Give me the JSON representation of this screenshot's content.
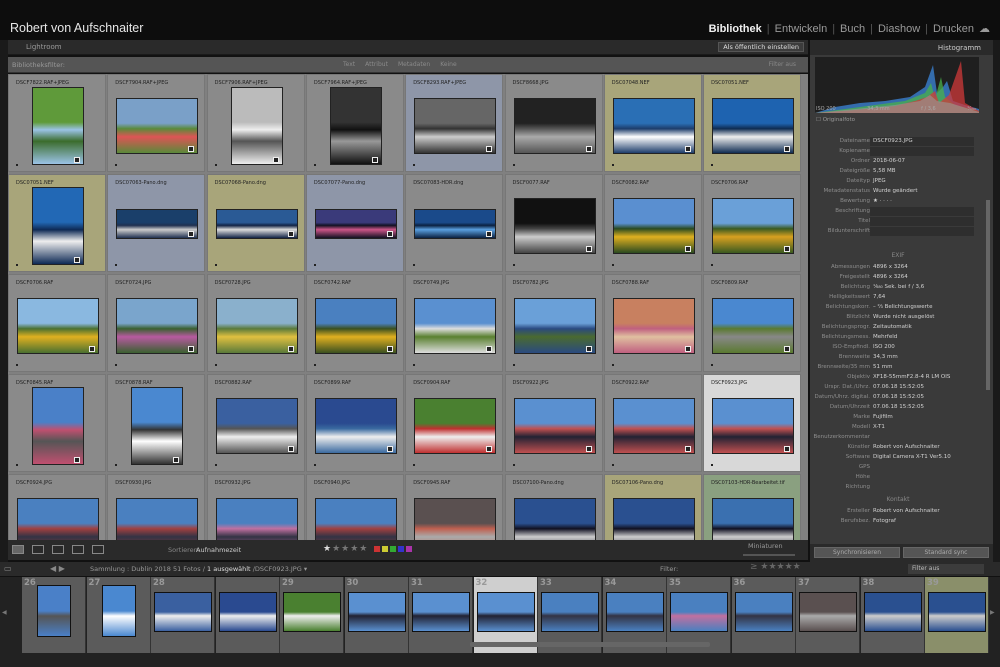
{
  "header": {
    "user": "Robert von Aufschnaiter",
    "modules": [
      "Bibliothek",
      "Entwickeln",
      "Buch",
      "Diashow",
      "Drucken"
    ],
    "active": "Bibliothek"
  },
  "pathbar": {
    "label": "Lightroom",
    "publish": "Als öffentlich einstellen"
  },
  "filterbar": {
    "title": "Bibliotheksfilter:",
    "tabs": [
      "Text",
      "Attribut",
      "Metadaten",
      "Keine"
    ],
    "off": "Filter aus"
  },
  "grid": [
    {
      "name": "DSCF7822.RAF+JPEG",
      "tone": "v",
      "colors": [
        "#5f9a3a",
        "#3b6c2c",
        "#9bc3e6"
      ],
      "bg": ""
    },
    {
      "name": "DSCF7904.RAF+JPEG",
      "tone": "h",
      "colors": [
        "#7aa0c8",
        "#d55",
        "#5a8a3a"
      ],
      "bg": ""
    },
    {
      "name": "DSCF7906.RAF+JPEG",
      "tone": "v",
      "colors": [
        "#bbb",
        "#555",
        "#eee"
      ],
      "bg": ""
    },
    {
      "name": "DSCF7964.RAF+JPEG",
      "tone": "v",
      "colors": [
        "#333",
        "#999",
        "#111"
      ],
      "bg": "#8a8a8a"
    },
    {
      "name": "DSCF8293.RAF+JPEG",
      "tone": "h",
      "colors": [
        "#666",
        "#ccc",
        "#333"
      ],
      "bg": "#8e96a8"
    },
    {
      "name": "DSCF8668.JPG",
      "tone": "h",
      "colors": [
        "#222",
        "#aaa",
        "#555"
      ],
      "bg": ""
    },
    {
      "name": "DSC07048.NEF",
      "tone": "h",
      "colors": [
        "#2a6fb5",
        "#fff",
        "#1d3d6b"
      ],
      "bg": "#a8a57a"
    },
    {
      "name": "DSC07051.NEF",
      "tone": "h",
      "colors": [
        "#1e63b0",
        "#eee",
        "#0f2c52"
      ],
      "bg": "#a8a57a"
    },
    {
      "name": "DSC07051.NEF",
      "tone": "v",
      "colors": [
        "#2268b5",
        "#eee",
        "#0e2a55"
      ],
      "bg": "#a8a57a"
    },
    {
      "name": "DSC07063-Pano.dng",
      "tone": "p",
      "colors": [
        "#1a3f6a",
        "#ccc",
        "#203050"
      ],
      "bg": "#8e96a8"
    },
    {
      "name": "DSC07068-Pano.dng",
      "tone": "p",
      "colors": [
        "#2a5a95",
        "#ddd",
        "#112244"
      ],
      "bg": "#a8a57a"
    },
    {
      "name": "DSC07077-Pano.dng",
      "tone": "p",
      "colors": [
        "#3a3a7a",
        "#c58",
        "#112"
      ],
      "bg": "#8e96a8"
    },
    {
      "name": "DSC07083-HDR.dng",
      "tone": "p",
      "colors": [
        "#1a4a8a",
        "#5aa0e0",
        "#0a2040"
      ],
      "bg": ""
    },
    {
      "name": "DSCF0077.RAF",
      "tone": "h",
      "colors": [
        "#111",
        "#ccc",
        "#444"
      ],
      "bg": ""
    },
    {
      "name": "DSCF0082.RAF",
      "tone": "h",
      "colors": [
        "#5a8fd0",
        "#e0b020",
        "#2a4a20"
      ],
      "bg": ""
    },
    {
      "name": "DSCF0706.RAF",
      "tone": "h",
      "colors": [
        "#6aa0d8",
        "#d8a020",
        "#3a5a20"
      ],
      "bg": ""
    },
    {
      "name": "DSCF0706.RAF",
      "tone": "h",
      "colors": [
        "#8ab8e0",
        "#e0b020",
        "#4a7030"
      ],
      "bg": ""
    },
    {
      "name": "DSCF0724.JPG",
      "tone": "h",
      "colors": [
        "#7aa5cc",
        "#b75aa0",
        "#3a6030"
      ],
      "bg": ""
    },
    {
      "name": "DSCF0728.JPG",
      "tone": "h",
      "colors": [
        "#8ab0cc",
        "#e0c040",
        "#5a7a3a"
      ],
      "bg": ""
    },
    {
      "name": "DSCF0742.RAF",
      "tone": "h",
      "colors": [
        "#4a80c0",
        "#e0b020",
        "#3a5020"
      ],
      "bg": ""
    },
    {
      "name": "DSCF0749.JPG",
      "tone": "h",
      "colors": [
        "#5a90d0",
        "#5a8030",
        "#ddd"
      ],
      "bg": ""
    },
    {
      "name": "DSCF0782.JPG",
      "tone": "h",
      "colors": [
        "#6aa0d8",
        "#4a6a30",
        "#2a4a80"
      ],
      "bg": ""
    },
    {
      "name": "DSCF0788.RAF",
      "tone": "h",
      "colors": [
        "#c88060",
        "#e0c0a0",
        "#c06080"
      ],
      "bg": ""
    },
    {
      "name": "DSCF0809.RAF",
      "tone": "h",
      "colors": [
        "#4a88d0",
        "#888",
        "#5a7a30"
      ],
      "bg": ""
    },
    {
      "name": "DSCF0845.RAF",
      "tone": "v",
      "colors": [
        "#4a80c8",
        "#555",
        "#c05070"
      ],
      "bg": ""
    },
    {
      "name": "DSCF0878.RAF",
      "tone": "v",
      "colors": [
        "#4a88d0",
        "#fff",
        "#333"
      ],
      "bg": ""
    },
    {
      "name": "DSCF0882.RAF",
      "tone": "h",
      "colors": [
        "#3a60a0",
        "#eee",
        "#555"
      ],
      "bg": ""
    },
    {
      "name": "DSCF0899.RAF",
      "tone": "h",
      "colors": [
        "#2a4a90",
        "#eee",
        "#3a6aa0"
      ],
      "bg": ""
    },
    {
      "name": "DSCF0904.RAF",
      "tone": "h",
      "colors": [
        "#4a8030",
        "#eee",
        "#c03030"
      ],
      "bg": ""
    },
    {
      "name": "DSCF0922.JPG",
      "tone": "h",
      "colors": [
        "#5a90d0",
        "#223",
        "#c05050"
      ],
      "bg": ""
    },
    {
      "name": "DSCF0922.RAF",
      "tone": "h",
      "colors": [
        "#5a90d0",
        "#223",
        "#c05050"
      ],
      "bg": ""
    },
    {
      "name": "DSCF0923.JPG",
      "tone": "h",
      "colors": [
        "#5a90d0",
        "#223",
        "#c05050"
      ],
      "bg": "#d8d8d8",
      "sel": true
    },
    {
      "name": "DSCF0924.JPG",
      "tone": "h",
      "colors": [
        "#4a80c0",
        "#334",
        "#a04040"
      ],
      "bg": ""
    },
    {
      "name": "DSCF0930.JPG",
      "tone": "h",
      "colors": [
        "#4a80c0",
        "#334",
        "#a04040"
      ],
      "bg": ""
    },
    {
      "name": "DSCF0932.JPG",
      "tone": "h",
      "colors": [
        "#4a80c0",
        "#334",
        "#c070a0"
      ],
      "bg": ""
    },
    {
      "name": "DSCF0940.JPG",
      "tone": "h",
      "colors": [
        "#4a80c0",
        "#334",
        "#a04040"
      ],
      "bg": ""
    },
    {
      "name": "DSCF0945.RAF",
      "tone": "h",
      "colors": [
        "#5a5050",
        "#aaa",
        "#c06050"
      ],
      "bg": ""
    },
    {
      "name": "DSC07100-Pano.dng",
      "tone": "h",
      "colors": [
        "#2a5090",
        "#ccc",
        "#112"
      ],
      "bg": ""
    },
    {
      "name": "DSC07106-Pano.dng",
      "tone": "h",
      "colors": [
        "#2a5090",
        "#ccc",
        "#112"
      ],
      "bg": "#a8a57a"
    },
    {
      "name": "DSC07103-HDR-Bearbeitet.tif",
      "tone": "h",
      "colors": [
        "#3a70b0",
        "#ccc",
        "#112"
      ],
      "bg": "#8aa080"
    }
  ],
  "toolbar": {
    "sort_label": "Sortieren:",
    "sort_value": "Aufnahmezeit",
    "thumbs_label": "Miniaturen"
  },
  "histogram": {
    "title": "Histogramm",
    "iso": "ISO 200",
    "focal": "34,3 mm",
    "aperture": "f / 3,6",
    "shutter": "¹⁄₆₈₀",
    "original": "Originalfoto"
  },
  "metadata": [
    {
      "k": "Dateiname",
      "v": "DSCF0923.JPG",
      "f": true
    },
    {
      "k": "Kopiename",
      "v": "",
      "f": true
    },
    {
      "k": "Ordner",
      "v": "2018-06-07"
    },
    {
      "k": "Dateigröße",
      "v": "5,58 MB"
    },
    {
      "k": "Dateityp",
      "v": "JPEG"
    },
    {
      "k": "Metadatenstatus",
      "v": "Wurde geändert"
    },
    {
      "k": "Bewertung",
      "v": "★ · · · ·"
    },
    {
      "k": "Beschriftung",
      "v": "",
      "f": true
    },
    {
      "k": "Titel",
      "v": "",
      "f": true
    },
    {
      "k": "Bildunterschrift",
      "v": "",
      "f": true
    }
  ],
  "exif_title": "EXIF",
  "exif": [
    {
      "k": "Abmessungen",
      "v": "4896 x 3264"
    },
    {
      "k": "Freigestellt",
      "v": "4896 x 3264"
    },
    {
      "k": "Belichtung",
      "v": "¹⁄₆₈₀ Sek. bei f / 3,6"
    },
    {
      "k": "Helligkeitswert",
      "v": "7,64"
    },
    {
      "k": "Belichtungskorr.",
      "v": "– ²⁄₃ Belichtungswerte"
    },
    {
      "k": "Blitzlicht",
      "v": "Wurde nicht ausgelöst"
    },
    {
      "k": "Belichtungsprogr.",
      "v": "Zeitautomatik"
    },
    {
      "k": "Belichtungsmess.",
      "v": "Mehrfeld"
    },
    {
      "k": "ISO-Empfindl.",
      "v": "ISO 200"
    },
    {
      "k": "Brennweite",
      "v": "34,3 mm"
    },
    {
      "k": "Brennweite/35 mm",
      "v": "51 mm"
    },
    {
      "k": "Objektiv",
      "v": "XF18-55mmF2.8-4 R LM OIS"
    },
    {
      "k": "Urspr. Dat./Uhrz.",
      "v": "07.06.18 15:52:05"
    },
    {
      "k": "Datum/Uhrz. digital.",
      "v": "07.06.18 15:52:05"
    },
    {
      "k": "Datum/Uhrzeit",
      "v": "07.06.18 15:52:05"
    },
    {
      "k": "Marke",
      "v": "Fujifilm"
    },
    {
      "k": "Modell",
      "v": "X-T1"
    },
    {
      "k": "Benutzerkommentar",
      "v": ""
    },
    {
      "k": "Künstler",
      "v": "Robert von Aufschnaiter"
    },
    {
      "k": "Software",
      "v": "Digital Camera X-T1 Ver5.10"
    },
    {
      "k": "GPS",
      "v": ""
    },
    {
      "k": "Höhe",
      "v": ""
    },
    {
      "k": "Richtung",
      "v": ""
    }
  ],
  "contact_title": "Kontakt",
  "contact": [
    {
      "k": "Ersteller",
      "v": "Robert von Aufschnaiter"
    },
    {
      "k": "Berufsbez.",
      "v": "Fotograf"
    }
  ],
  "rbuttons": [
    "Synchronisieren",
    "Standard sync"
  ],
  "filmstrip_bar": {
    "prefix": "Sammlung : Dublin 2018",
    "count": "51 Fotos /",
    "selected": "1 ausgewählt",
    "file": "/DSCF0923.JPG ▾",
    "filter": "Filter:",
    "off": "Filter aus"
  },
  "film": [
    {
      "n": "26",
      "colors": [
        "#4a80c8",
        "#555"
      ]
    },
    {
      "n": "27",
      "colors": [
        "#4a88d0",
        "#fff"
      ]
    },
    {
      "n": "28",
      "colors": [
        "#3a60a0",
        "#eee"
      ]
    },
    {
      "n": "",
      "colors": [
        "#2a4a90",
        "#eee"
      ]
    },
    {
      "n": "29",
      "colors": [
        "#4a8030",
        "#eee"
      ]
    },
    {
      "n": "30",
      "colors": [
        "#5a90d0",
        "#223"
      ]
    },
    {
      "n": "31",
      "colors": [
        "#5a90d0",
        "#223"
      ]
    },
    {
      "n": "32",
      "colors": [
        "#5a90d0",
        "#223"
      ],
      "sel": true
    },
    {
      "n": "33",
      "colors": [
        "#4a80c0",
        "#334"
      ]
    },
    {
      "n": "34",
      "colors": [
        "#4a80c0",
        "#334"
      ]
    },
    {
      "n": "35",
      "colors": [
        "#4a80c0",
        "#c070a0"
      ]
    },
    {
      "n": "36",
      "colors": [
        "#4a80c0",
        "#334"
      ]
    },
    {
      "n": "37",
      "colors": [
        "#5a5050",
        "#aaa"
      ]
    },
    {
      "n": "38",
      "colors": [
        "#2a5090",
        "#ccc"
      ]
    },
    {
      "n": "39",
      "colors": [
        "#2a5090",
        "#ccc"
      ]
    }
  ]
}
